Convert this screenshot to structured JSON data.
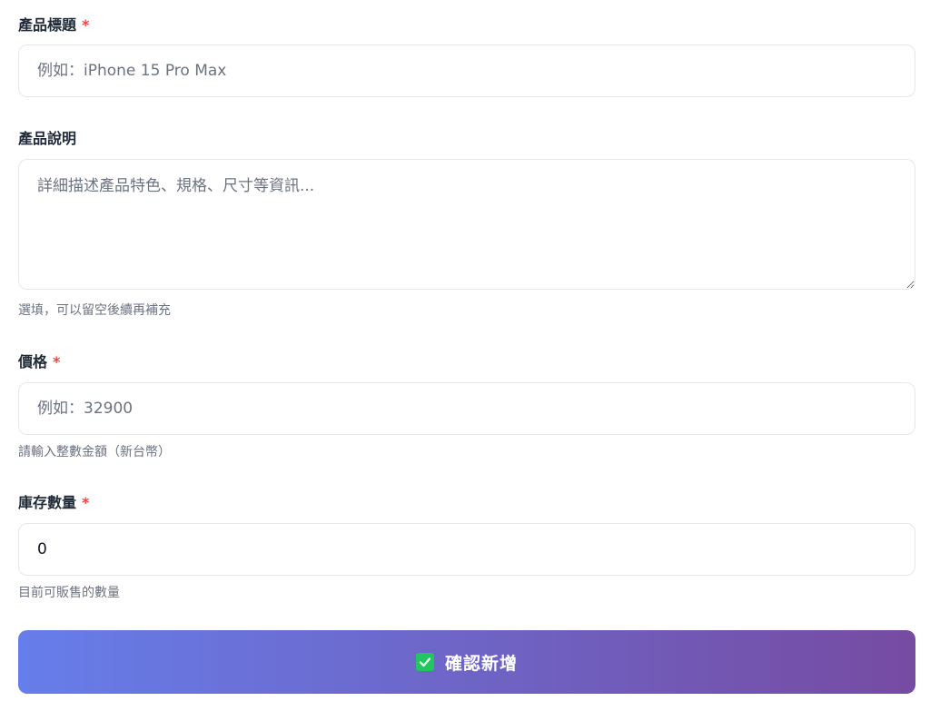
{
  "form": {
    "title_field": {
      "label": "產品標題",
      "required_mark": "*",
      "placeholder": "例如：iPhone 15 Pro Max",
      "value": ""
    },
    "description_field": {
      "label": "產品說明",
      "placeholder": "詳細描述產品特色、規格、尺寸等資訊...",
      "value": "",
      "hint": "選填，可以留空後續再補充"
    },
    "price_field": {
      "label": "價格",
      "required_mark": "*",
      "placeholder": "例如：32900",
      "value": "",
      "hint": "請輸入整數金額（新台幣）"
    },
    "stock_field": {
      "label": "庫存數量",
      "required_mark": "*",
      "value": "0",
      "hint": "目前可販售的數量"
    },
    "submit_button": {
      "label": "確認新增",
      "icon": "check-box-icon"
    }
  },
  "colors": {
    "required": "#ef4444",
    "button_gradient_start": "#667eea",
    "button_gradient_end": "#764ba2",
    "check_icon": "#22c55e",
    "hint_text": "#6b7280",
    "input_border": "#e5e7eb"
  }
}
